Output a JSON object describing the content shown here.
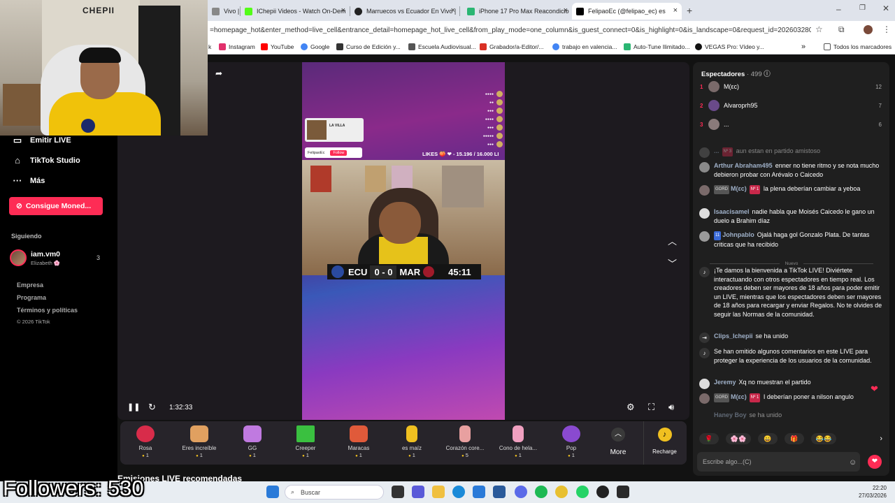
{
  "browser": {
    "tabs": [
      {
        "label": "Vivo |",
        "favicon_color": "#888888"
      },
      {
        "label": "IChepii Videos - Watch On-Dem",
        "favicon_color": "#53fc18"
      },
      {
        "label": "Marruecos vs Ecuador En Vivo |",
        "favicon_color": "#222222"
      },
      {
        "label": "iPhone 17 Pro Max Reacondicio",
        "favicon_color": "#2bb673"
      },
      {
        "label": "FelipaoEc (@felipao_ec) es",
        "favicon_color": "#000000"
      }
    ],
    "new_tab": "+",
    "url": "=homepage_hot&enter_method=live_cell&entrance_detail=homepage_hot_live_cell&from_play_mode=one_column&is_guest_connect=0&is_highlight=0&is_landscape=0&request_id=20260328051942EA96...",
    "bookmarks": [
      {
        "label": "k",
        "color": "#888888"
      },
      {
        "label": "Instagram",
        "color": "#e1306c"
      },
      {
        "label": "YouTube",
        "color": "#ff0000"
      },
      {
        "label": "Google",
        "color": "#4285f4"
      },
      {
        "label": "Curso de Edición y...",
        "color": "#333333"
      },
      {
        "label": "Escuela Audiovisual...",
        "color": "#555555"
      },
      {
        "label": "Grabador/a-Editor/...",
        "color": "#d93025"
      },
      {
        "label": "trabajo en valencia...",
        "color": "#4285f4"
      },
      {
        "label": "Auto-Tune Ilimitado...",
        "color": "#2bb673"
      },
      {
        "label": "VEGAS Pro: Vídeo y...",
        "color": "#111111"
      }
    ],
    "bookmarks_more": "»",
    "all_bookmarks": "Todos los marcadores"
  },
  "webcam": {
    "sign": "CHEPII"
  },
  "leftnav": {
    "items": [
      {
        "label": "Emitir LIVE",
        "icon": "video-icon"
      },
      {
        "label": "TikTok Studio",
        "icon": "home-icon"
      },
      {
        "label": "Más",
        "icon": "more-dots-icon"
      }
    ],
    "coins_button": "Consigue Moned...",
    "following_header": "Siguiendo",
    "following": [
      {
        "name": "iam.vm0",
        "sub": "Elizabeth 🌸",
        "count": "3"
      }
    ],
    "footer_links": [
      "Empresa",
      "Programa",
      "Términos y políticas"
    ],
    "copyright": "© 2026 TikTok"
  },
  "stream": {
    "spotify_title": "LA VILLA",
    "follow_name": "FelipaoEc",
    "follow_btn": "Follow",
    "likes": "LIKES 🍑 ❤ - 15.196 / 16.000 LI",
    "team_left": "ECU",
    "score_left": "0",
    "score_right": "0",
    "team_right": "MAR",
    "match_time": "45:11",
    "elapsed": "1:32:33"
  },
  "gifts": [
    {
      "name": "Rosa",
      "price": "1",
      "color": "#d82c4a"
    },
    {
      "name": "Eres increíble",
      "price": "1",
      "color": "#e0a060"
    },
    {
      "name": "GG",
      "price": "1",
      "color": "#c07ae0"
    },
    {
      "name": "Creeper",
      "price": "1",
      "color": "#3ac040"
    },
    {
      "name": "Maracas",
      "price": "1",
      "color": "#e05a3a"
    },
    {
      "name": "es maíz",
      "price": "1",
      "color": "#f0c020"
    },
    {
      "name": "Corazón core...",
      "price": "5",
      "color": "#e8a0a0"
    },
    {
      "name": "Cono de hela...",
      "price": "1",
      "color": "#f0a0c0"
    },
    {
      "name": "Pop",
      "price": "1",
      "color": "#8a4ad0"
    }
  ],
  "gift_more": "More",
  "recharge": "Recharge",
  "recommended": "Emisiones LIVE recomendadas",
  "chat": {
    "viewers_label": "Espectadores",
    "viewers_count": "· 499",
    "ranking": [
      {
        "rank": "1",
        "name": "M(εc)",
        "score": "12"
      },
      {
        "rank": "2",
        "name": "Alvaroprh95",
        "score": "7"
      },
      {
        "rank": "3",
        "name": "...",
        "score": "6"
      }
    ],
    "messages": [
      {
        "user": "...",
        "badges": [
          "Nº 3"
        ],
        "text": "aun estan en partido amistoso"
      },
      {
        "user": "Arthur Abraham495",
        "badges": [],
        "text": "enner no tiene ritmo y se nota mucho debieron probar con Arévalo o Caicedo"
      },
      {
        "user": "M(εc)",
        "badges": [
          "GORD",
          "Nº 1"
        ],
        "text": "la plena deberían cambiar a yeboa"
      },
      {
        "user": "Isaacisamel",
        "badges": [],
        "text": "nadie habla que Moisés Caicedo le gano un duelo a Brahim díaz"
      },
      {
        "user": "Johnpablo",
        "badges": [
          "11"
        ],
        "text": "Ojalá haga gol Gonzalo Plata. De tantas criticas que ha recibido"
      }
    ],
    "new_label": "Nuevo",
    "system_welcome": "¡Te damos la bienvenida a TikTok LIVE! Diviértete interactuando con otros espectadores en tiempo real. Los creadores deben ser mayores de 18 años para poder emitir un LIVE, mientras que los espectadores deben ser mayores de 18 años para recargar y enviar Regalos. No te olvides de seguir las Normas de la comunidad.",
    "joined_user": "Clips_Ichepii",
    "joined_text": "se ha unido",
    "system_omitted": "Se han omitido algunos comentarios en este LIVE para proteger la experiencia de los usuarios de la comunidad.",
    "messages2": [
      {
        "user": "Jeremy",
        "badges": [],
        "text": "Xq no muestran el partido"
      },
      {
        "user": "M(εc)",
        "badges": [
          "GORD",
          "Nº 1"
        ],
        "text": "I deberían poner a nilson angulo"
      },
      {
        "user": "Haney Boy",
        "badges": [],
        "text": "se ha unido"
      }
    ],
    "emojis": [
      "🌹",
      "🌸🌸",
      "😄",
      "🎁",
      "😂😂"
    ],
    "input_placeholder": "Escribe algo...(C)"
  },
  "overlay": {
    "followers": "Followers: 530"
  },
  "taskbar": {
    "search": "Buscar",
    "time": "22:20",
    "date": "27/03/2026"
  }
}
